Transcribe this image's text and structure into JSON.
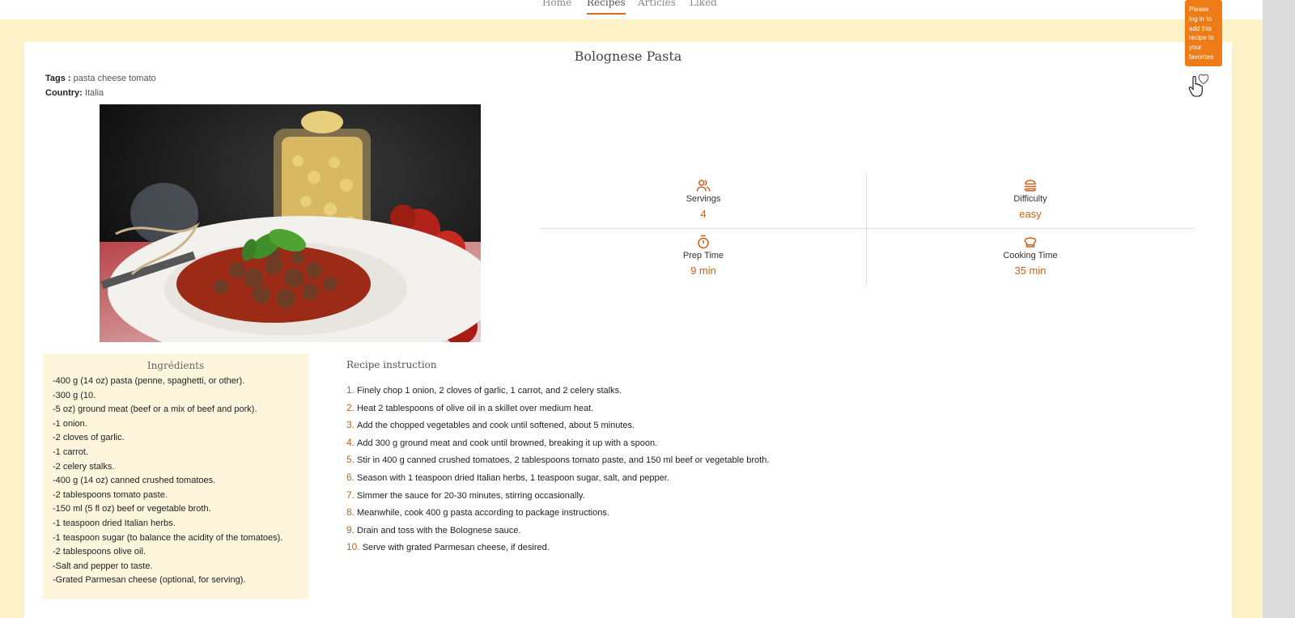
{
  "nav": {
    "items": [
      {
        "label": "Home"
      },
      {
        "label": "Recipes"
      },
      {
        "label": "Articles"
      },
      {
        "label": "Liked"
      }
    ],
    "active": "Recipes"
  },
  "recipe": {
    "title": "Bolognese Pasta",
    "tags_label": "Tags :",
    "tags": "pasta cheese tomato",
    "country_label": "Country:",
    "country": "Italia"
  },
  "stats": {
    "servings": {
      "label": "Servings",
      "value": "4",
      "icon": "users-icon"
    },
    "difficulty": {
      "label": "Difficulty",
      "value": "easy",
      "icon": "burger-icon"
    },
    "prep_time": {
      "label": "Prep Time",
      "value": "9 min",
      "icon": "stopwatch-icon"
    },
    "cooking_time": {
      "label": "Cooking Time",
      "value": "35 min",
      "icon": "chef-hat-icon"
    }
  },
  "ingredients": {
    "title": "Ingrédients",
    "items": [
      "-400 g (14 oz) pasta (penne, spaghetti, or other).",
      "-300 g (10.",
      "-5 oz) ground meat (beef or a mix of beef and pork).",
      "-1 onion.",
      "-2 cloves of garlic.",
      "-1 carrot.",
      "-2 celery stalks.",
      "-400 g (14 oz) canned crushed tomatoes.",
      "-2 tablespoons tomato paste.",
      "-150 ml (5 fl oz) beef or vegetable broth.",
      "-1 teaspoon dried Italian herbs.",
      "-1 teaspoon sugar (to balance the acidity of the tomatoes).",
      "-2 tablespoons olive oil.",
      "-Salt and pepper to taste.",
      "-Grated Parmesan cheese (optional, for serving)."
    ]
  },
  "instructions": {
    "title": "Recipe instruction",
    "steps": [
      {
        "num": "1.",
        "text": "Finely chop 1 onion, 2 cloves of garlic, 1 carrot, and 2 celery stalks."
      },
      {
        "num": "2.",
        "text": "Heat 2 tablespoons of olive oil in a skillet over medium heat."
      },
      {
        "num": "3.",
        "text": "Add the chopped vegetables and cook until softened, about 5 minutes."
      },
      {
        "num": "4.",
        "text": "Add 300 g ground meat and cook until browned, breaking it up with a spoon."
      },
      {
        "num": "5.",
        "text": "Stir in 400 g canned crushed tomatoes, 2 tablespoons tomato paste, and 150 ml beef or vegetable broth."
      },
      {
        "num": "6.",
        "text": "Season with 1 teaspoon dried Italian herbs, 1 teaspoon sugar, salt, and pepper."
      },
      {
        "num": "7.",
        "text": "Simmer the sauce for 20-30 minutes, stirring occasionally."
      },
      {
        "num": "8.",
        "text": "Meanwhile, cook 400 g pasta according to package instructions."
      },
      {
        "num": "9.",
        "text": "Drain and toss with the Bolognese sauce."
      },
      {
        "num": "10.",
        "text": "Serve with grated Parmesan cheese, if desired."
      }
    ]
  },
  "tooltip": {
    "text": "Please log in to add this recipe to your favorites"
  },
  "icons": {
    "favorite": "heart-icon",
    "cursor": "hand-pointer-icon"
  },
  "colors": {
    "accent": "#c8621c",
    "tooltip": "#ef7b16",
    "page_bg": "#fdf1c8",
    "ingredients_bg": "#fdf6dd"
  }
}
